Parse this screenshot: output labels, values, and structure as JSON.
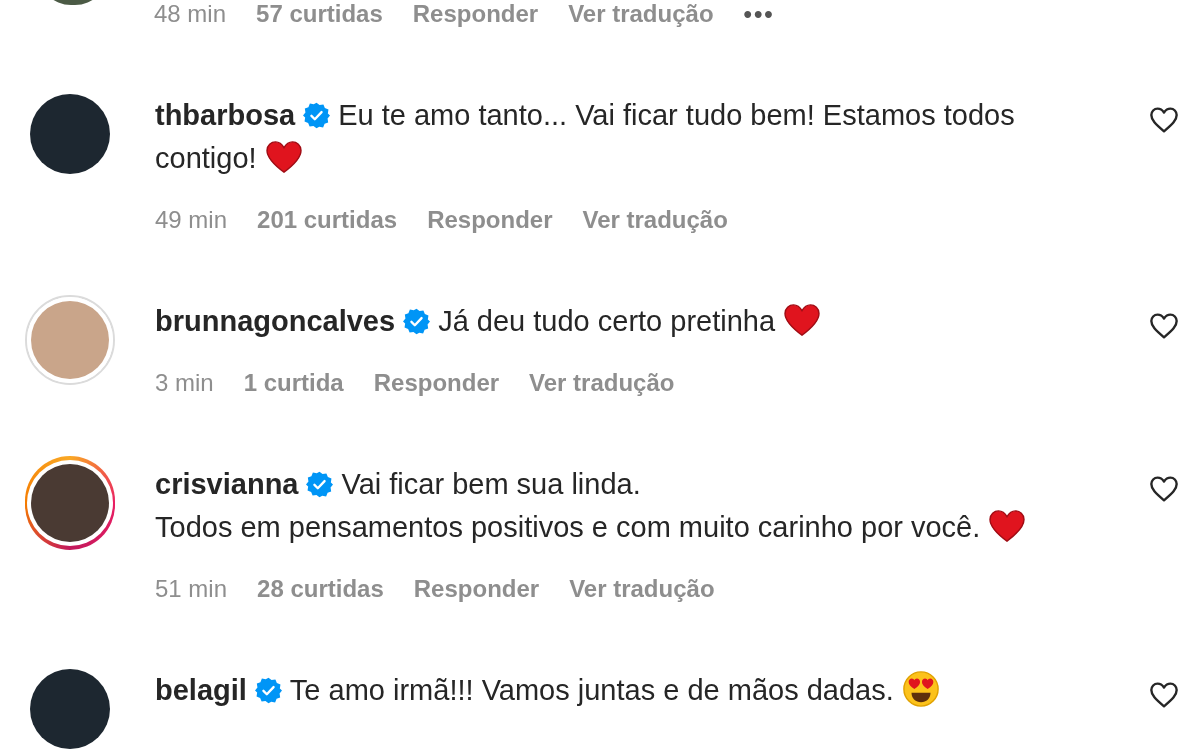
{
  "comments": [
    {
      "time": "48 min",
      "likes": "57 curtidas",
      "reply": "Responder",
      "translate": "Ver tradução",
      "more": "•••"
    },
    {
      "username": "thbarbosa",
      "verified": true,
      "story_ring": false,
      "text": "Eu te amo tanto... Vai ficar tudo bem! Estamos todos contigo!",
      "emoji": {
        "kind": "red_heart"
      },
      "time": "49 min",
      "likes": "201 curtidas",
      "reply": "Responder",
      "translate": "Ver tradução",
      "liked": false
    },
    {
      "username": "brunnagoncalves",
      "verified": true,
      "story_ring": true,
      "story_seen": true,
      "text": "Já deu tudo certo pretinha",
      "emoji": {
        "kind": "red_heart"
      },
      "time": "3 min",
      "likes": "1 curtida",
      "reply": "Responder",
      "translate": "Ver tradução",
      "liked": false
    },
    {
      "username": "crisvianna",
      "verified": true,
      "story_ring": true,
      "story_seen": false,
      "text": "Vai ficar bem sua linda.\nTodos em pensamentos positivos e com muito carinho por você.",
      "emoji": {
        "kind": "red_heart"
      },
      "time": "51 min",
      "likes": "28 curtidas",
      "reply": "Responder",
      "translate": "Ver tradução",
      "liked": false
    },
    {
      "username": "belagil",
      "verified": true,
      "story_ring": false,
      "text": "Te amo irmã!!! Vamos juntas e de mãos dadas.",
      "emoji": {
        "kind": "heart_eyes"
      },
      "liked": false
    }
  ]
}
